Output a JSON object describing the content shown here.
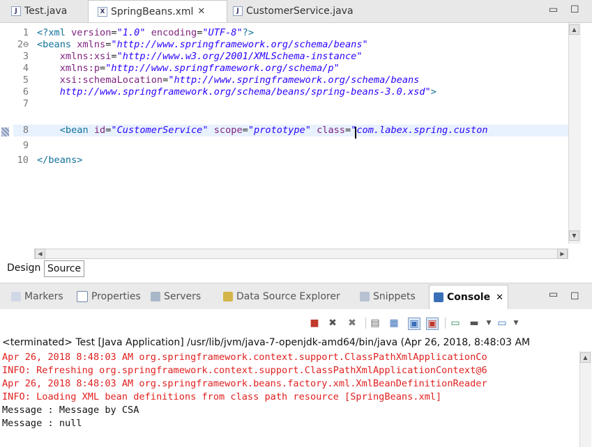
{
  "editor_tabs": [
    {
      "label": "Test.java",
      "icon": "java-file-icon",
      "active": false
    },
    {
      "label": "SpringBeans.xml",
      "icon": "xml-file-icon",
      "active": true
    },
    {
      "label": "CustomerService.java",
      "icon": "java-file-icon",
      "active": false
    }
  ],
  "editor": {
    "lines": [
      {
        "n": "1",
        "fold": ""
      },
      {
        "n": "2",
        "fold": "⊖"
      },
      {
        "n": "3",
        "fold": ""
      },
      {
        "n": "4",
        "fold": ""
      },
      {
        "n": "5",
        "fold": ""
      },
      {
        "n": "6",
        "fold": ""
      },
      {
        "n": "7",
        "fold": ""
      },
      {
        "n": "8",
        "fold": ""
      },
      {
        "n": "9",
        "fold": ""
      },
      {
        "n": "10",
        "fold": ""
      }
    ],
    "l1": {
      "a": "<?xml ",
      "b": "version",
      "c": "=",
      "d": "\"1.0\"",
      "e": " encoding",
      "f": "=",
      "g": "\"UTF-8\"",
      "h": "?>"
    },
    "l2": {
      "a": "<beans ",
      "b": "xmlns",
      "c": "=",
      "d": "\"http://www.springframework.org/schema/beans\""
    },
    "l3": {
      "b": "xmlns:xsi",
      "c": "=",
      "d": "\"http://www.w3.org/2001/XMLSchema-instance\""
    },
    "l4": {
      "b": "xmlns:p",
      "c": "=",
      "d": "\"http://www.springframework.org/schema/p\""
    },
    "l5": {
      "b": "xsi:schemaLocation",
      "c": "=",
      "d": "\"http://www.springframework.org/schema/beans"
    },
    "l6": {
      "d": "http://www.springframework.org/schema/beans/spring-beans-3.0.xsd\"",
      "h": ">"
    },
    "l8": {
      "a": "<bean ",
      "b": "id",
      "c": "=",
      "d": "\"CustomerService\"",
      "b2": " scope",
      "c2": "=",
      "d2": "\"prototype\"",
      "b3": " class",
      "c3": "=",
      "d3": "\"com.labex.spring.custon"
    },
    "l10": {
      "a": "</beans>"
    }
  },
  "bottom_tabs": {
    "design": "Design",
    "source": "Source"
  },
  "panel_tabs": [
    {
      "label": "Markers",
      "icon": "markers-icon"
    },
    {
      "label": "Properties",
      "icon": "properties-icon"
    },
    {
      "label": "Servers",
      "icon": "servers-icon"
    },
    {
      "label": "Data Source Explorer",
      "icon": "data-source-icon"
    },
    {
      "label": "Snippets",
      "icon": "snippets-icon"
    },
    {
      "label": "Console",
      "icon": "console-icon",
      "active": true
    }
  ],
  "console": {
    "terminated": "<terminated> Test [Java Application] /usr/lib/jvm/java-7-openjdk-amd64/bin/java (Apr 26, 2018, 8:48:03 AM",
    "lines": [
      {
        "text": "Apr 26, 2018 8:48:03 AM org.springframework.context.support.ClassPathXmlApplicationCo",
        "kind": "err"
      },
      {
        "text": "INFO: Refreshing org.springframework.context.support.ClassPathXmlApplicationContext@6",
        "kind": "err"
      },
      {
        "text": "Apr 26, 2018 8:48:03 AM org.springframework.beans.factory.xml.XmlBeanDefinitionReader",
        "kind": "err"
      },
      {
        "text": "INFO: Loading XML bean definitions from class path resource [SpringBeans.xml]",
        "kind": "err"
      },
      {
        "text": "Message : Message by CSA",
        "kind": "out"
      },
      {
        "text": "Message : null",
        "kind": "out"
      }
    ]
  },
  "colors": {
    "tag": "#11709a",
    "attr": "#7d1f7d",
    "value": "#2a00ff",
    "error": "#e02020"
  }
}
